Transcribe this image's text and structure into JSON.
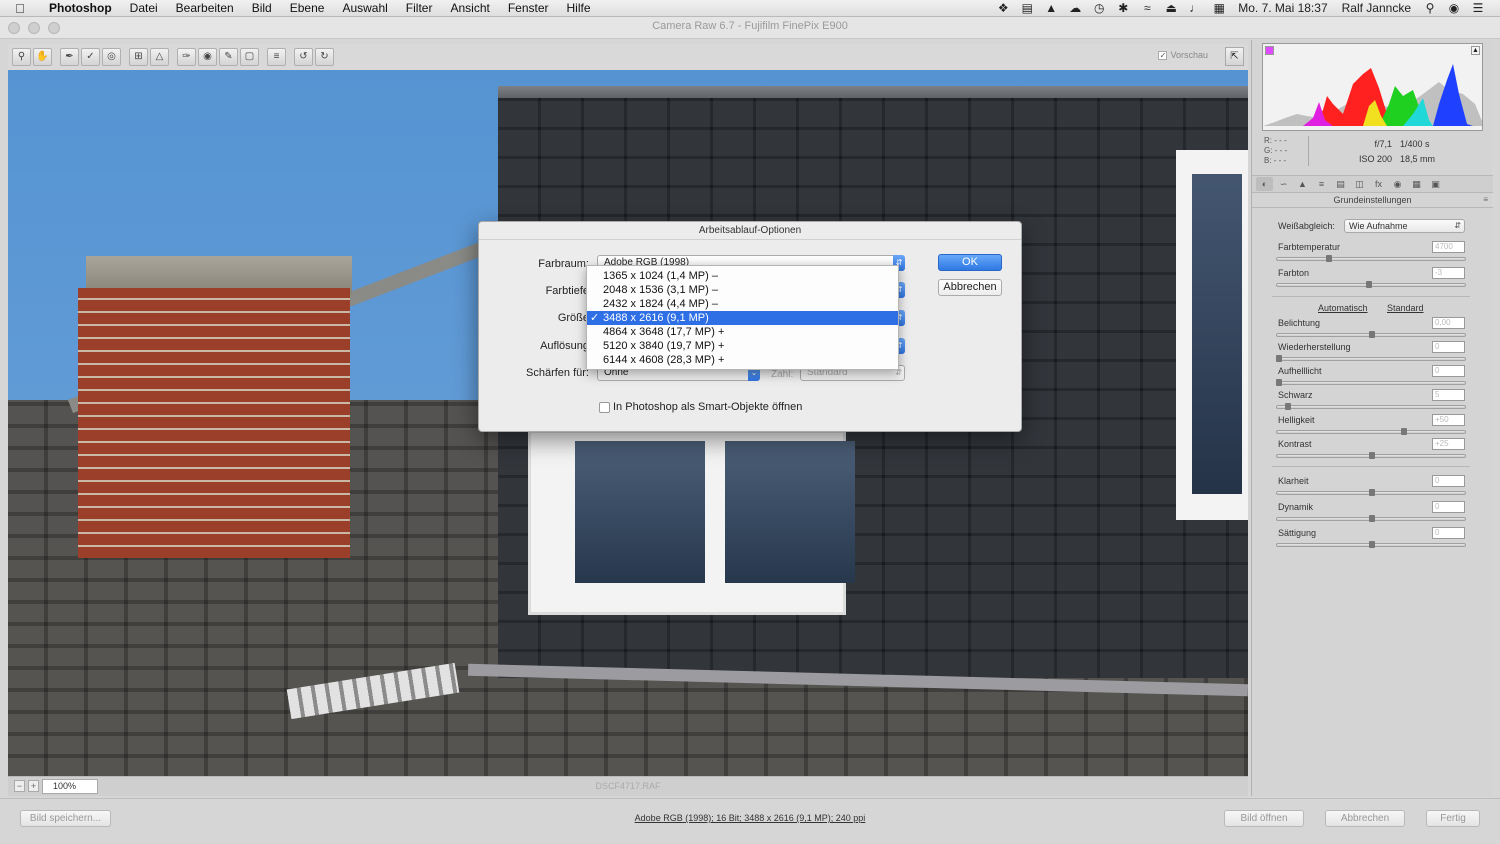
{
  "menubar": {
    "app": "Photoshop",
    "items": [
      "Datei",
      "Bearbeiten",
      "Bild",
      "Ebene",
      "Auswahl",
      "Filter",
      "Ansicht",
      "Fenster",
      "Hilfe"
    ],
    "datetime": "Mo. 7. Mai  18:37",
    "user": "Ralf Janncke"
  },
  "window": {
    "title": "Camera Raw 6.7  -  Fujifilm FinePix E900"
  },
  "toolbar": {
    "preview_label": "Vorschau",
    "preview_checked": "✓"
  },
  "canvas": {
    "zoom": "100%",
    "filename": "DSCF4717.RAF"
  },
  "histogram": {
    "rgb": [
      "R:  - - -",
      "G:  - - -",
      "B:  - - -"
    ],
    "aperture": "f/7,1",
    "shutter": "1/400 s",
    "iso": "ISO 200",
    "focal": "18,5 mm"
  },
  "panel": {
    "title": "Grundeinstellungen",
    "wb_label": "Weißabgleich:",
    "wb_value": "Wie Aufnahme",
    "temperature_label": "Farbtemperatur",
    "temperature_value": "4700",
    "tint_label": "Farbton",
    "tint_value": "-3",
    "auto_link": "Automatisch",
    "default_link": "Standard",
    "sliders": [
      {
        "label": "Belichtung",
        "value": "0,00"
      },
      {
        "label": "Wiederherstellung",
        "value": "0"
      },
      {
        "label": "Aufhelllicht",
        "value": "0"
      },
      {
        "label": "Schwarz",
        "value": "5"
      },
      {
        "label": "Helligkeit",
        "value": "+50"
      },
      {
        "label": "Kontrast",
        "value": "+25"
      }
    ],
    "sliders2": [
      {
        "label": "Klarheit",
        "value": "0"
      },
      {
        "label": "Dynamik",
        "value": "0"
      },
      {
        "label": "Sättigung",
        "value": "0"
      }
    ]
  },
  "bottom": {
    "save_label": "Bild speichern...",
    "workflow_link": "Adobe RGB (1998); 16 Bit; 3488 x 2616 (9,1 MP); 240 ppi",
    "open_label": "Bild öffnen",
    "cancel_label": "Abbrechen",
    "done_label": "Fertig"
  },
  "dialog": {
    "title": "Arbeitsablauf-Optionen",
    "farbraum_label": "Farbraum:",
    "farbraum_value": "Adobe RGB (1998)",
    "farbtiefe_label": "Farbtiefe",
    "groesse_label": "Größe",
    "aufloesung_label": "Auflösung",
    "schaerfen_label": "Schärfen für:",
    "schaerfen_value": "Ohne",
    "zahl_label": "Zahl:",
    "zahl_value": "Standard",
    "ok_label": "OK",
    "cancel_label": "Abbrechen",
    "smart_label": "In Photoshop als Smart-Objekte öffnen",
    "size_options": [
      {
        "label": "1365 x 1024 (1,4 MP)  –",
        "check": ""
      },
      {
        "label": "2048 x 1536 (3,1 MP)  –",
        "check": ""
      },
      {
        "label": "2432 x 1824 (4,4 MP)  –",
        "check": ""
      },
      {
        "label": "3488 x 2616 (9,1 MP)",
        "check": "✓"
      },
      {
        "label": "4864 x 3648 (17,7 MP)  +",
        "check": ""
      },
      {
        "label": "5120 x 3840 (19,7 MP)  +",
        "check": ""
      },
      {
        "label": "6144 x 4608 (28,3 MP)  +",
        "check": ""
      }
    ]
  }
}
